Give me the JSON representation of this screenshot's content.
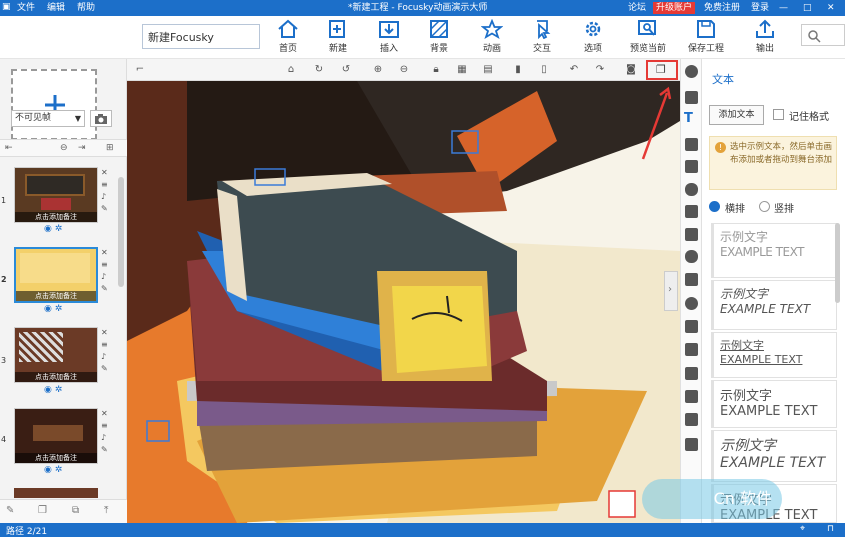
{
  "titlebar": {
    "menu": [
      "文件",
      "编辑",
      "帮助"
    ],
    "title": "*新建工程 - Focusky动画演示大师",
    "forum": "论坛",
    "upgrade": "升级账户",
    "register": "免费注册",
    "login": "登录",
    "controls": [
      "—",
      "□",
      "✕"
    ]
  },
  "ribbon": {
    "project_name": "新建Focusky",
    "buttons": [
      "首页",
      "新建",
      "插入",
      "背景",
      "动画",
      "交互",
      "选项",
      "预览当前",
      "保存工程",
      "输出"
    ]
  },
  "left_panel": {
    "visibility_select": "不可见帧",
    "slides": [
      {
        "num": "1",
        "caption": "点击添加备注"
      },
      {
        "num": "2",
        "caption": "点击添加备注"
      },
      {
        "num": "3",
        "caption": "点击添加备注"
      },
      {
        "num": "4",
        "caption": "点击添加备注"
      }
    ]
  },
  "right_panel": {
    "title": "文本",
    "add_text_button": "添加文本",
    "remember_format": "记住格式",
    "hint": "选中示例文本，然后单击画布添加或者拖动到舞台添加",
    "horizontal": "横排",
    "vertical": "竖排",
    "example_cn": "示例文字",
    "example_en": "EXAMPLE TEXT"
  },
  "status": {
    "path": "路径 2/21"
  },
  "watermark": "Cn 软件",
  "colors": {
    "titlebar": "#1c6fc9",
    "upgrade": "#e53935",
    "highlight": "#e53935",
    "accent": "#1c6fc9"
  }
}
